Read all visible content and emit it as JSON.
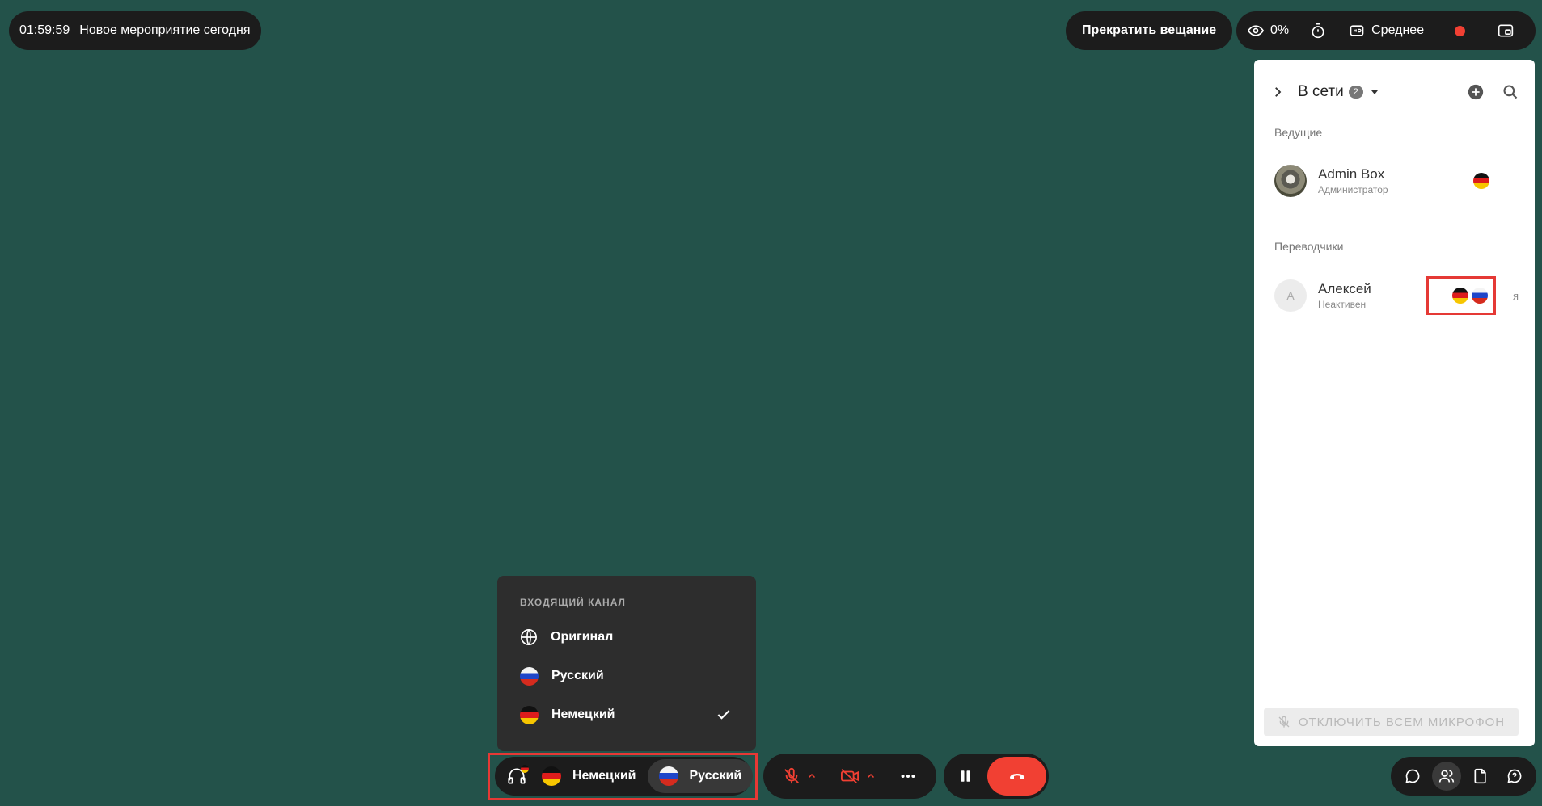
{
  "top_bar": {
    "timer": "01:59:59",
    "event_title": "Новое мероприятие сегодня",
    "stop_button": "Прекратить вещание",
    "viewers_percent": "0%",
    "quality": "Среднее",
    "record_indicator_color": "#f14033"
  },
  "panel": {
    "title": "В сети",
    "online_count": "2",
    "hosts_label": "Ведущие",
    "translators_label": "Переводчики",
    "hosts": [
      {
        "name": "Admin Box",
        "role": "Администратор",
        "languages": [
          "de"
        ]
      }
    ],
    "translators": [
      {
        "name": "Алексей",
        "status": "Неактивен",
        "initial": "А",
        "languages": [
          "de",
          "ru"
        ],
        "me_label": "я"
      }
    ],
    "mute_all_button": "ОТКЛЮЧИТЬ ВСЕМ МИКРОФОН"
  },
  "channel_menu": {
    "header": "ВХОДЯЩИЙ КАНАЛ",
    "items": [
      {
        "label": "Оригинал",
        "icon": "globe-icon",
        "selected": false
      },
      {
        "label": "Русский",
        "icon": "flag-ru",
        "selected": false
      },
      {
        "label": "Немецкий",
        "icon": "flag-de",
        "selected": true
      }
    ]
  },
  "bottom_bar": {
    "incoming_language": "Немецкий",
    "outgoing_language": "Русский"
  },
  "colors": {
    "background": "#23524a",
    "dark": "#1c1c1c",
    "accent_red": "#f14033",
    "highlight": "#e53935"
  }
}
